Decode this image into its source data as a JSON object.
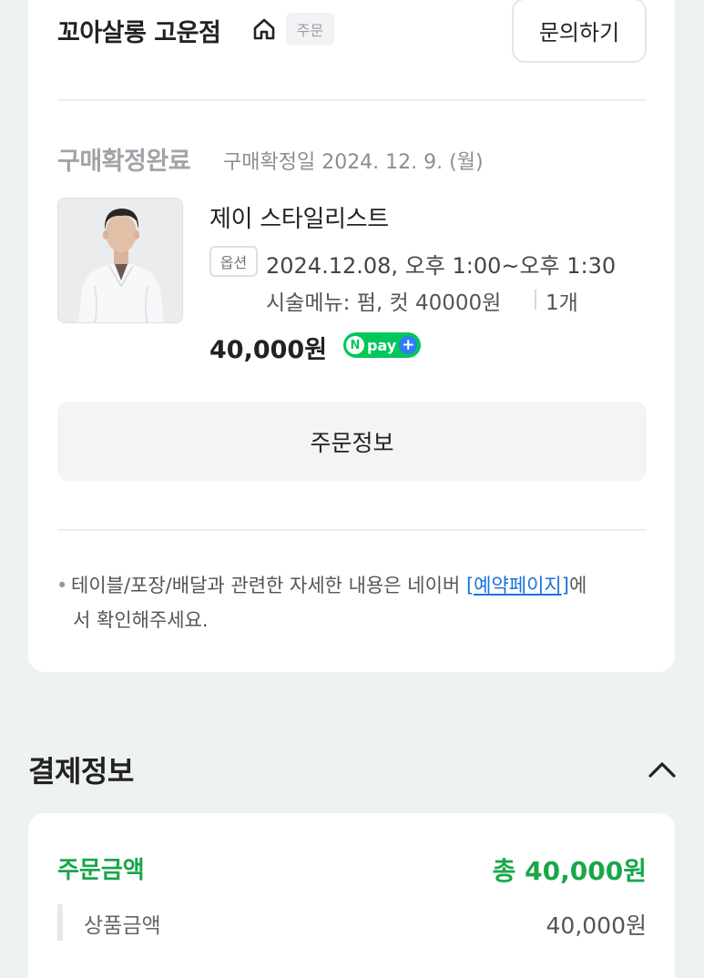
{
  "order": {
    "store_name": "꼬아살롱 고운점",
    "store_icon": "home-icon",
    "chip_label": "주문",
    "inquiry_button": "문의하기",
    "status": "구매확정완료",
    "confirm_date": "구매확정일 2024. 12. 9. (월)",
    "item": {
      "thumbnail": "stylist-photo",
      "name": "제이 스타일리스트",
      "option_badge": "옵션",
      "option_datetime": "2024.12.08, 오후 1:00~오후 1:30",
      "menu_line": "시술메뉴: 펌, 컷 40000원",
      "quantity": "1개",
      "price": "40,000원",
      "npay": {
        "n_letter": "N",
        "label": "pay",
        "plus": "+",
        "color": "#03c75a"
      }
    },
    "order_info_button": "주문정보",
    "notice": {
      "bullet": "•",
      "text_before": "테이블/포장/배달과 관련한 자세한 내용은 네이버 ",
      "link": "[예약페이지]",
      "text_after_line1": "에",
      "text_line2": "서 확인해주세요."
    }
  },
  "payment": {
    "title": "결제정보",
    "collapse_icon": "chevron-up-icon",
    "order_amount_label": "주문금액",
    "order_amount_total": "총 40,000원",
    "product_amount_label": "상품금액",
    "product_amount_value": "40,000원",
    "accent_color": "#19a64a"
  }
}
